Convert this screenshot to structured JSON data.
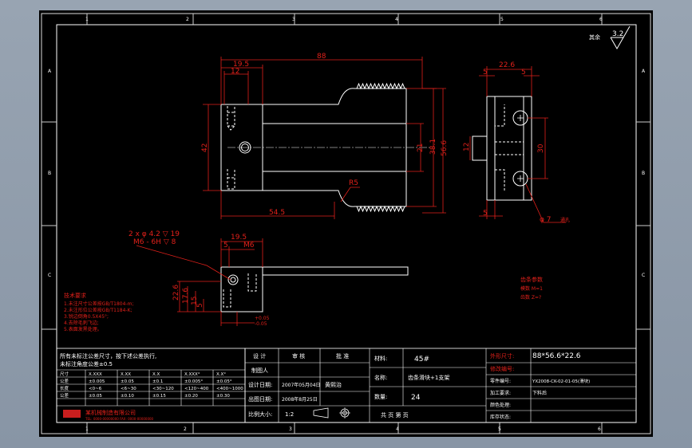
{
  "border_markers": {
    "top": [
      "1",
      "2",
      "3",
      "4",
      "5",
      "6"
    ],
    "bottom": [
      "1",
      "2",
      "3",
      "4",
      "5",
      "6"
    ],
    "left": [
      "A",
      "B",
      "C"
    ],
    "right": [
      "A",
      "B",
      "C"
    ]
  },
  "roughness": {
    "label": "其余",
    "value": "3.2"
  },
  "front_view": {
    "dims": {
      "overall_length": "88",
      "left_block": "19.5",
      "left_inner": "12",
      "height": "42",
      "slot_width": "21",
      "rack_height": "38.1",
      "total_height": "56.6",
      "radius": "R5",
      "bottom_length": "54.5"
    }
  },
  "side_view": {
    "dims": {
      "width": "22.6",
      "left_step": "5",
      "right_step": "5",
      "boss": "12",
      "hole_spacing": "30",
      "bottom_step": "5",
      "hole_dia": "φ 7"
    },
    "note": "通孔"
  },
  "top_view": {
    "callout_line1": "2 x φ 4.2 ▽ 19",
    "callout_line2": "M6 - 6H ▽ 8",
    "dims": {
      "width": "19.5",
      "step": "5",
      "thread": "M6",
      "h1": "22.6",
      "h2": "17.6",
      "h3": "15",
      "h4": "5",
      "tol_top": "+0.05",
      "tol_bottom": "-0.05"
    }
  },
  "tech_requirements": {
    "title": "技术要求",
    "lines": [
      "1.未注尺寸公差按GB/T1804-m;",
      "2.未注形位公差按GB/T1184-K;",
      "3.锐边倒角0.5X45°;",
      "4.去除毛刺飞边;",
      "5.表面发黑处理。"
    ]
  },
  "right_note": {
    "line1": "齿条参数",
    "line2": "模数 M=1",
    "line3": "齿数 Z=?"
  },
  "tolerance_table": {
    "header_line1": "所有未标注公差尺寸，按下述公差执行,",
    "header_line2": "未标注角度公差±0.5",
    "rows": [
      [
        "尺寸",
        "X.XXX",
        "X.XX",
        "X.X",
        "X.XXX°",
        "X.X°"
      ],
      [
        "公差",
        "±0.005",
        "±0.05",
        "±0.1",
        "±0.005°",
        "±0.05°"
      ],
      [
        "长度",
        "<0~6",
        "<6~30",
        "<30~120",
        "<120~400",
        "<400~1000"
      ],
      [
        "公差",
        "±0.05",
        "±0.10",
        "±0.15",
        "±0.20",
        "±0.30"
      ]
    ],
    "company": "某机械制造有限公司",
    "company_sub": "TEL: 0000-00000000  FAX: 0000-00000000"
  },
  "title_block": {
    "design": "设 计",
    "review": "审 核",
    "approve": "批 准",
    "drafter": "制图人",
    "design_date": "设计日期:",
    "design_date_val": "2007年05月04日",
    "drafter_name": "黄熙治",
    "print_date": "出图日期:",
    "print_date_val": "2008年8月25日",
    "scale_label": "比例大小:",
    "scale_val": "1:2",
    "material_label": "材料:",
    "material_val": "45#",
    "name_label": "名称:",
    "name_val": "齿条滑块+1支架",
    "qty_label": "数量:",
    "qty_val": "24",
    "page_label": "共  页  第  页",
    "size_label": "外形尺寸:",
    "size_val": "88*56.6*22.6",
    "modify_label": "修改编号:",
    "partno_label": "零件编号:",
    "partno_val": "YX2008-CK-02-01-05(滑块)",
    "process_label": "加工要求:",
    "process_val": "下料后",
    "color_label": "颜色处理:",
    "stock_label": "库存状态:"
  }
}
